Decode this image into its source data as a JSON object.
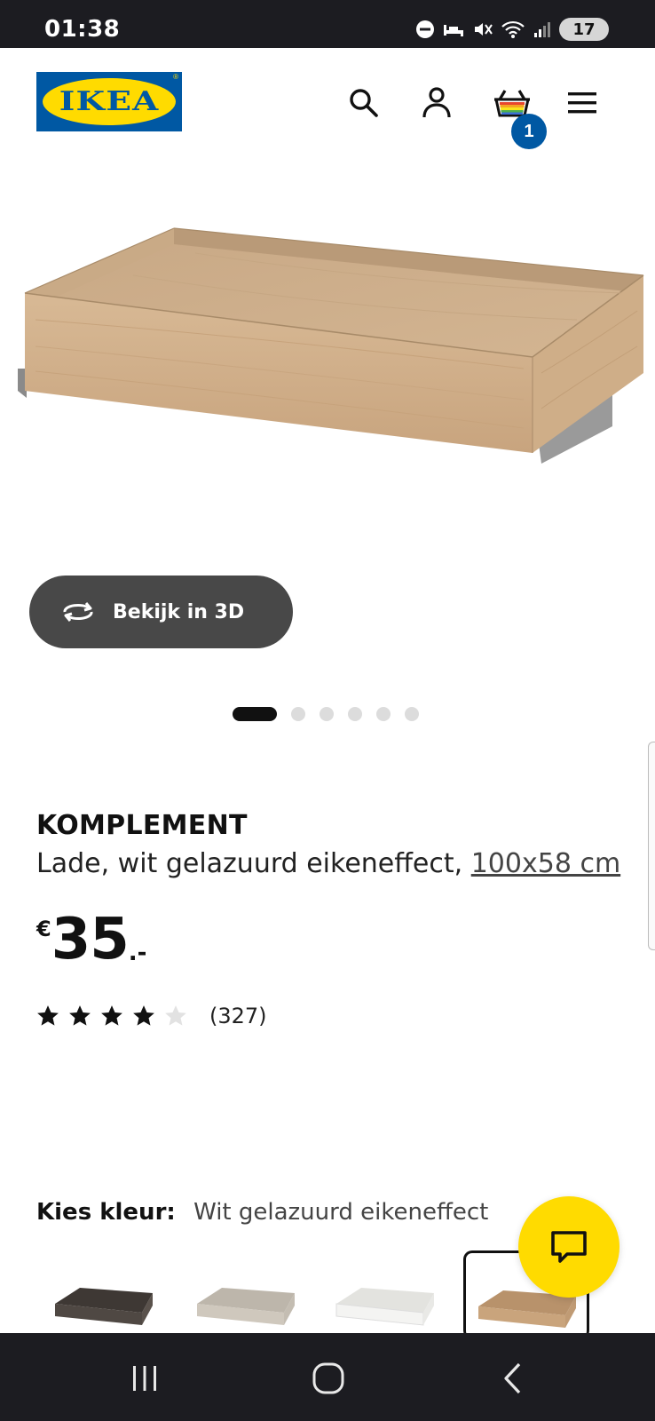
{
  "status_bar": {
    "time": "01:38",
    "battery": "17",
    "icons": [
      "do-not-disturb-icon",
      "sleep-mode-icon",
      "mute-icon",
      "wifi-icon",
      "signal-icon",
      "battery-icon"
    ]
  },
  "header": {
    "logo_text": "IKEA",
    "cart_count": "1",
    "icons": [
      "search-icon",
      "account-icon",
      "cart-icon",
      "menu-icon"
    ]
  },
  "product": {
    "view_3d_label": "Bekijk in 3D",
    "carousel": {
      "total": 6,
      "active": 0
    },
    "name": "KOMPLEMENT",
    "description": "Lade, wit gelazuurd eikeneffect,",
    "size": "100x58 cm",
    "price": {
      "currency": "€",
      "integer": "35",
      "decimal": ".-"
    },
    "rating": {
      "stars": 4,
      "max": 5,
      "count": "(327)"
    }
  },
  "color_picker": {
    "label": "Kies kleur:",
    "value": "Wit gelazuurd eikeneffect",
    "options": [
      {
        "name": "dark-grey",
        "color": "#4f4843"
      },
      {
        "name": "beige",
        "color": "#cfc8bd"
      },
      {
        "name": "white",
        "color": "#f4f4f2"
      },
      {
        "name": "white-stained-oak",
        "color": "#c9a47c"
      }
    ],
    "selected_index": 3
  },
  "colors": {
    "ikea_blue": "#0058a3",
    "ikea_yellow": "#ffdb00",
    "button_dark": "#484848",
    "system_bar": "#1c1c21"
  }
}
